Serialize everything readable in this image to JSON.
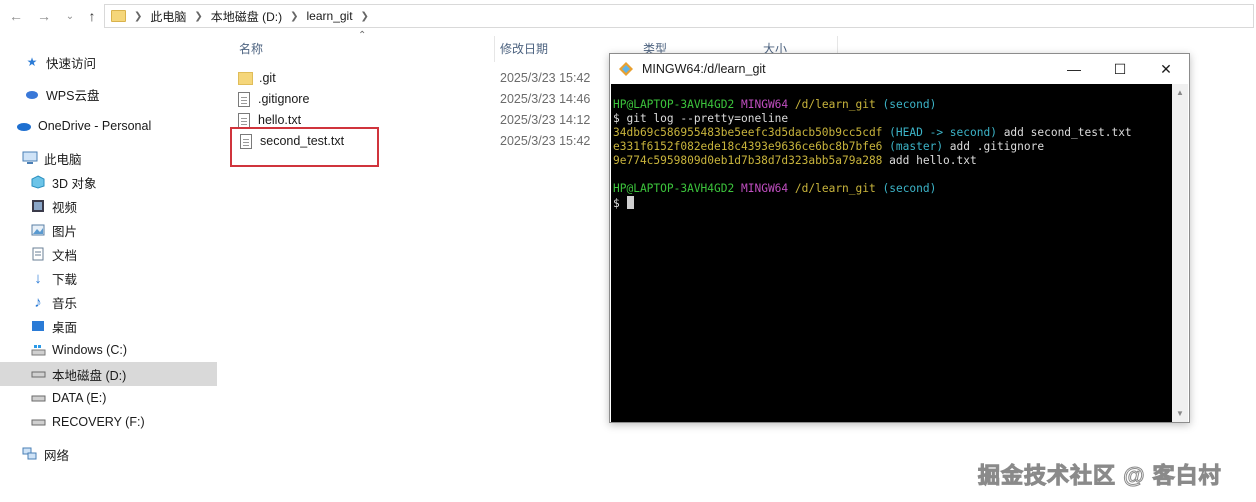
{
  "address_bar": {
    "crumbs": [
      "此电脑",
      "本地磁盘 (D:)",
      "learn_git"
    ]
  },
  "sidebar": {
    "items": [
      {
        "label": "快速访问",
        "icon": "star-icon"
      },
      {
        "label": "WPS云盘",
        "icon": "cloud-icon"
      },
      {
        "label": "OneDrive - Personal",
        "icon": "onedrive-icon"
      },
      {
        "label": "此电脑",
        "icon": "computer-icon"
      },
      {
        "label": "3D 对象",
        "icon": "cube-icon"
      },
      {
        "label": "视频",
        "icon": "video-icon"
      },
      {
        "label": "图片",
        "icon": "picture-icon"
      },
      {
        "label": "文档",
        "icon": "document-icon"
      },
      {
        "label": "下载",
        "icon": "download-icon"
      },
      {
        "label": "音乐",
        "icon": "music-icon"
      },
      {
        "label": "桌面",
        "icon": "desktop-icon"
      },
      {
        "label": "Windows (C:)",
        "icon": "drive-icon"
      },
      {
        "label": "本地磁盘 (D:)",
        "icon": "drive-icon",
        "selected": true
      },
      {
        "label": "DATA (E:)",
        "icon": "drive-icon"
      },
      {
        "label": "RECOVERY (F:)",
        "icon": "drive-icon"
      },
      {
        "label": "网络",
        "icon": "network-icon"
      }
    ]
  },
  "file_list": {
    "columns": {
      "name": "名称",
      "modified": "修改日期",
      "type": "类型",
      "size": "大小"
    },
    "rows": [
      {
        "name": ".git",
        "modified": "2025/3/23 15:42",
        "kind": "folder"
      },
      {
        "name": ".gitignore",
        "modified": "2025/3/23 14:46",
        "kind": "file"
      },
      {
        "name": "hello.txt",
        "modified": "2025/3/23 14:12",
        "kind": "file"
      },
      {
        "name": "second_test.txt",
        "modified": "2025/3/23 15:42",
        "kind": "file",
        "highlighted": true
      }
    ]
  },
  "terminal": {
    "title": "MINGW64:/d/learn_git",
    "prompt_user": "HP@LAPTOP-3AVH4GD2",
    "prompt_env": "MINGW64",
    "prompt_path": "/d/learn_git",
    "prompt_branch": "(second)",
    "command": "$ git log --pretty=oneline",
    "log": [
      {
        "hash": "34db69c586955483be5eefc3d5dacb50b9cc5cdf",
        "ref": "(HEAD -> second)",
        "msg": " add second_test.txt"
      },
      {
        "hash": "e331f6152f082ede18c4393e9636ce6bc8b7bfe6",
        "ref": "(master)",
        "msg": " add .gitignore"
      },
      {
        "hash": "9e774c5959809d0eb1d7b38d7d323abb5a79a288",
        "ref": "",
        "msg": " add hello.txt"
      }
    ],
    "prompt_dollar": "$"
  },
  "watermark": "掘金技术社区 @ 客白村",
  "colors": {
    "highlight_box": "#d0343c",
    "selected_bg": "#d9d9d9",
    "terminal_bg": "#000000"
  }
}
